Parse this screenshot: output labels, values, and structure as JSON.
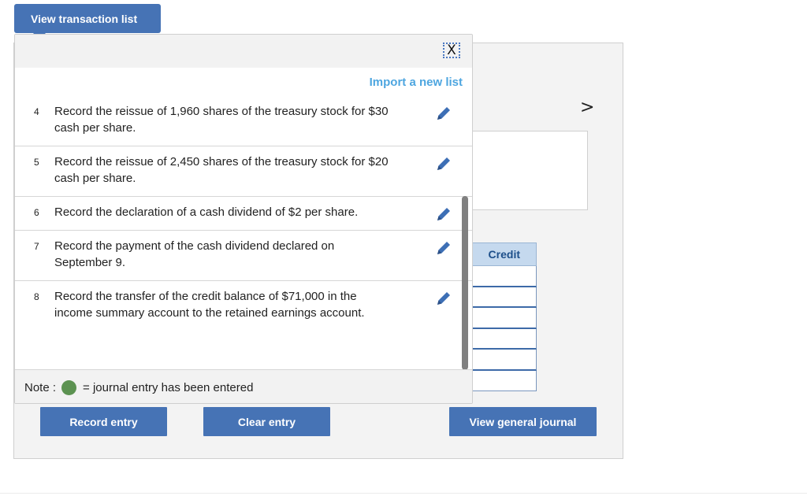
{
  "header": {
    "view_list_label": "View transaction list"
  },
  "popup": {
    "close_symbol": "X",
    "import_label": "Import a new list",
    "items": [
      {
        "num": "4",
        "text": "Record the reissue of 1,960 shares of the treasury stock for $30 cash per share."
      },
      {
        "num": "5",
        "text": "Record the reissue of 2,450 shares of the treasury stock for $20 cash per share."
      },
      {
        "num": "6",
        "text": "Record the declaration of a cash dividend of $2 per share."
      },
      {
        "num": "7",
        "text": "Record the payment of the cash dividend declared on September 9."
      },
      {
        "num": "8",
        "text": "Record the transfer of the credit balance of $71,000 in the income summary account to the retained earnings account."
      }
    ],
    "note": {
      "prefix": "Note :",
      "suffix": "= journal entry has been entered",
      "dot_color": "#5c9251"
    }
  },
  "background": {
    "nav_arrow": ">",
    "credit_header": "Credit"
  },
  "buttons": {
    "record_entry": "Record entry",
    "clear_entry": "Clear entry",
    "view_general_journal": "View general journal"
  },
  "colors": {
    "accent": "#4673b5",
    "link": "#4ea6e0",
    "edit_icon": "#3d6fb5"
  }
}
